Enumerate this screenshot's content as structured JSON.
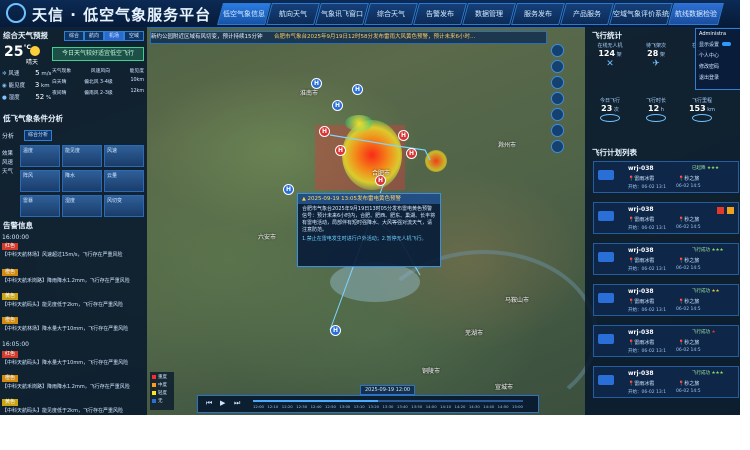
{
  "app": {
    "title": "天信 · 低空气象服务平台"
  },
  "nav": [
    "低空气象信息",
    "航向天气",
    "气象讯飞窗口",
    "综合天气",
    "告警发布",
    "数据管理",
    "服务发布",
    "产品服务",
    "空域气象评价系统",
    "航线数据检验"
  ],
  "user": {
    "name": "Administra",
    "menu": [
      "显示设置",
      "个人中心",
      "修改密码",
      "退出登录"
    ]
  },
  "ticker": "合肥市气象台2025年9月19日12时58分发布雷雨大风黄色预警，预计未来6小时…",
  "ticker_prefix": "新约公园附近区域有风切变，预计持续15分钟",
  "left": {
    "forecast_title": "综合天气预报",
    "tabs": [
      "综合",
      "航向",
      "机场",
      "空域"
    ],
    "temp": "25",
    "temp_unit": "°C",
    "weather": "晴天",
    "wind_label": "风速",
    "wind": "5",
    "wind_unit": "m/s",
    "vis_label": "能见度",
    "vis": "3",
    "vis_unit": "km",
    "hum_label": "湿度",
    "hum": "52",
    "hum_unit": "%",
    "advice": "今日天气较好适宜低空飞行",
    "small_table": [
      "天气现象",
      "风速风向",
      "能见度",
      "白天晴",
      "偏北风 3-4级",
      "10km",
      "夜间晴",
      "偏南风 2-3级",
      "12km"
    ],
    "analysis_title": "低飞气象条件分析",
    "analysis_tab": "综合分析",
    "labels": [
      "分析",
      "效果",
      "风速",
      "天气"
    ],
    "cards": [
      "温度",
      "能见度",
      "风速",
      "阵风",
      "降水",
      "云量",
      "雷暴",
      "湿度",
      "风切变"
    ],
    "alert_title": "告警信息",
    "alerts": [
      {
        "time": "16:00:00",
        "tag": "红色",
        "text": "【中科天航林场】风速超过15m/s，飞行存在严重风险"
      },
      {
        "time": "",
        "tag": "橙色",
        "text": "【中科天航禾岗路】降雨降水1.2mm，飞行存在严重风险"
      },
      {
        "time": "",
        "tag": "黄色",
        "text": "【中科天航码头】能见度低于2km，飞行存在严重风险"
      },
      {
        "time": "",
        "tag": "橙色",
        "text": "【中科天航林场】降水量大于10mm，飞行存在严重风险"
      },
      {
        "time": "16:05:00",
        "tag": "红色",
        "text": "【中科天航码头】降水量大于10mm，飞行存在严重风险"
      },
      {
        "time": "",
        "tag": "橙色",
        "text": "【中科天航禾岗路】降雨降水1.2mm，飞行存在严重风险"
      },
      {
        "time": "",
        "tag": "黄色",
        "text": "【中科天航码头】能见度低于2km，飞行存在严重风险"
      }
    ]
  },
  "map": {
    "cities": [
      "淮南市",
      "滁州市",
      "六安市",
      "合肥市",
      "芜湖市",
      "马鞍山市",
      "铜陵市",
      "宣城市"
    ],
    "popup_title": "2025-09-19 13:05发布雷电黄色预警",
    "popup_text": "合肥市气象台2025年9月19日13时05分发布雷电黄色预警信号：预计未来6小时内，合肥、肥西、肥东、巢湖、长丰将有雷电活动，局部伴有短时强降水、大风等强对流天气，请注意防范。",
    "popup_link": "1.禁止在雷电发生时进行户外活动；2.暂停无人机飞行。",
    "timeline_date": "2025-09-19 12:00",
    "timeline_ticks": [
      "12:00",
      "12:10",
      "12:20",
      "12:30",
      "12:40",
      "12:50",
      "13:00",
      "13:10",
      "13:20",
      "13:30",
      "13:40",
      "13:50",
      "14:00",
      "14:10",
      "14:20",
      "14:30",
      "14:40",
      "14:50",
      "15:00"
    ],
    "legend": [
      "重度",
      "中度",
      "轻度",
      "无"
    ],
    "legend_colors": [
      "#ff2a2a",
      "#ff9a1a",
      "#ffe31a",
      "#2a6fd8"
    ]
  },
  "right": {
    "stats_title": "飞行统计",
    "stats": [
      {
        "label": "在线无人机",
        "value": "124",
        "unit": "架"
      },
      {
        "label": "待飞架次",
        "value": "28",
        "unit": "架"
      },
      {
        "label": "在线机巢",
        "value": "22",
        "unit": ""
      },
      {
        "label": "今日飞行",
        "value": "23",
        "unit": "次"
      },
      {
        "label": "飞行时长",
        "value": "12",
        "unit": "h"
      },
      {
        "label": "飞行里程",
        "value": "153",
        "unit": "km"
      }
    ],
    "plan_title": "飞行计划列表",
    "flights": [
      {
        "name": "wrj-038",
        "status": "已起降",
        "route_from": "雷雨冰雹",
        "route_to": "秒之旅",
        "start": "开始：06-02 13:1",
        "end": "06-02 14:5",
        "stars": "★★★",
        "warn": true
      },
      {
        "name": "wrj-038",
        "status": "",
        "route_from": "雷雨冰雹",
        "route_to": "秒之旅",
        "start": "开始：06-02 13:1",
        "end": "06-02 14:5",
        "stars": "",
        "warn": false
      },
      {
        "name": "wrj-038",
        "status": "飞行成功",
        "route_from": "雷雨冰雹",
        "route_to": "秒之旅",
        "start": "开始：06-02 13:1",
        "end": "06-02 14:5",
        "stars": "★★★",
        "warn": false
      },
      {
        "name": "wrj-038",
        "status": "飞行成功",
        "route_from": "雷雨冰雹",
        "route_to": "秒之旅",
        "start": "开始：06-02 13:1",
        "end": "06-02 14:5",
        "stars": "★★",
        "warn": false
      },
      {
        "name": "wrj-038",
        "status": "飞行成功",
        "route_from": "雷雨冰雹",
        "route_to": "秒之旅",
        "start": "开始：06-02 13:1",
        "end": "06-02 14:5",
        "stars": "★",
        "warn": false
      },
      {
        "name": "wrj-038",
        "status": "飞行成功",
        "route_from": "雷雨冰雹",
        "route_to": "秒之旅",
        "start": "开始：06-02 13:1",
        "end": "06-02 14:5",
        "stars": "★★★",
        "warn": false
      }
    ]
  }
}
